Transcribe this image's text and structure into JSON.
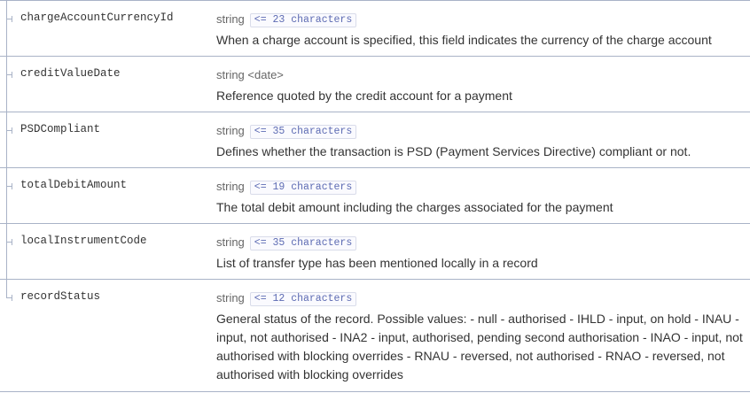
{
  "properties": [
    {
      "name": "chargeAccountCurrencyId",
      "type": "string",
      "constraint": "<= 23 characters",
      "description": "When a charge account is specified, this field indicates the currency of the charge account"
    },
    {
      "name": "creditValueDate",
      "type": "string <date>",
      "constraint": "",
      "description": "Reference quoted by the credit account for a payment"
    },
    {
      "name": "PSDCompliant",
      "type": "string",
      "constraint": "<= 35 characters",
      "description": "Defines whether the transaction is PSD (Payment Services Directive) compliant or not."
    },
    {
      "name": "totalDebitAmount",
      "type": "string",
      "constraint": "<= 19 characters",
      "description": "The total debit amount including the charges associated for the payment"
    },
    {
      "name": "localInstrumentCode",
      "type": "string",
      "constraint": "<= 35 characters",
      "description": "List of transfer type has been mentioned locally in a record"
    },
    {
      "name": "recordStatus",
      "type": "string",
      "constraint": "<= 12 characters",
      "description": "General status of the record. Possible values: - null - authorised - IHLD - input, on hold - INAU - input, not authorised - INA2 - input, authorised, pending second authorisation - INAO - input, not authorised with blocking overrides - RNAU - reversed, not authorised - RNAO - reversed, not authorised with blocking overrides"
    }
  ]
}
